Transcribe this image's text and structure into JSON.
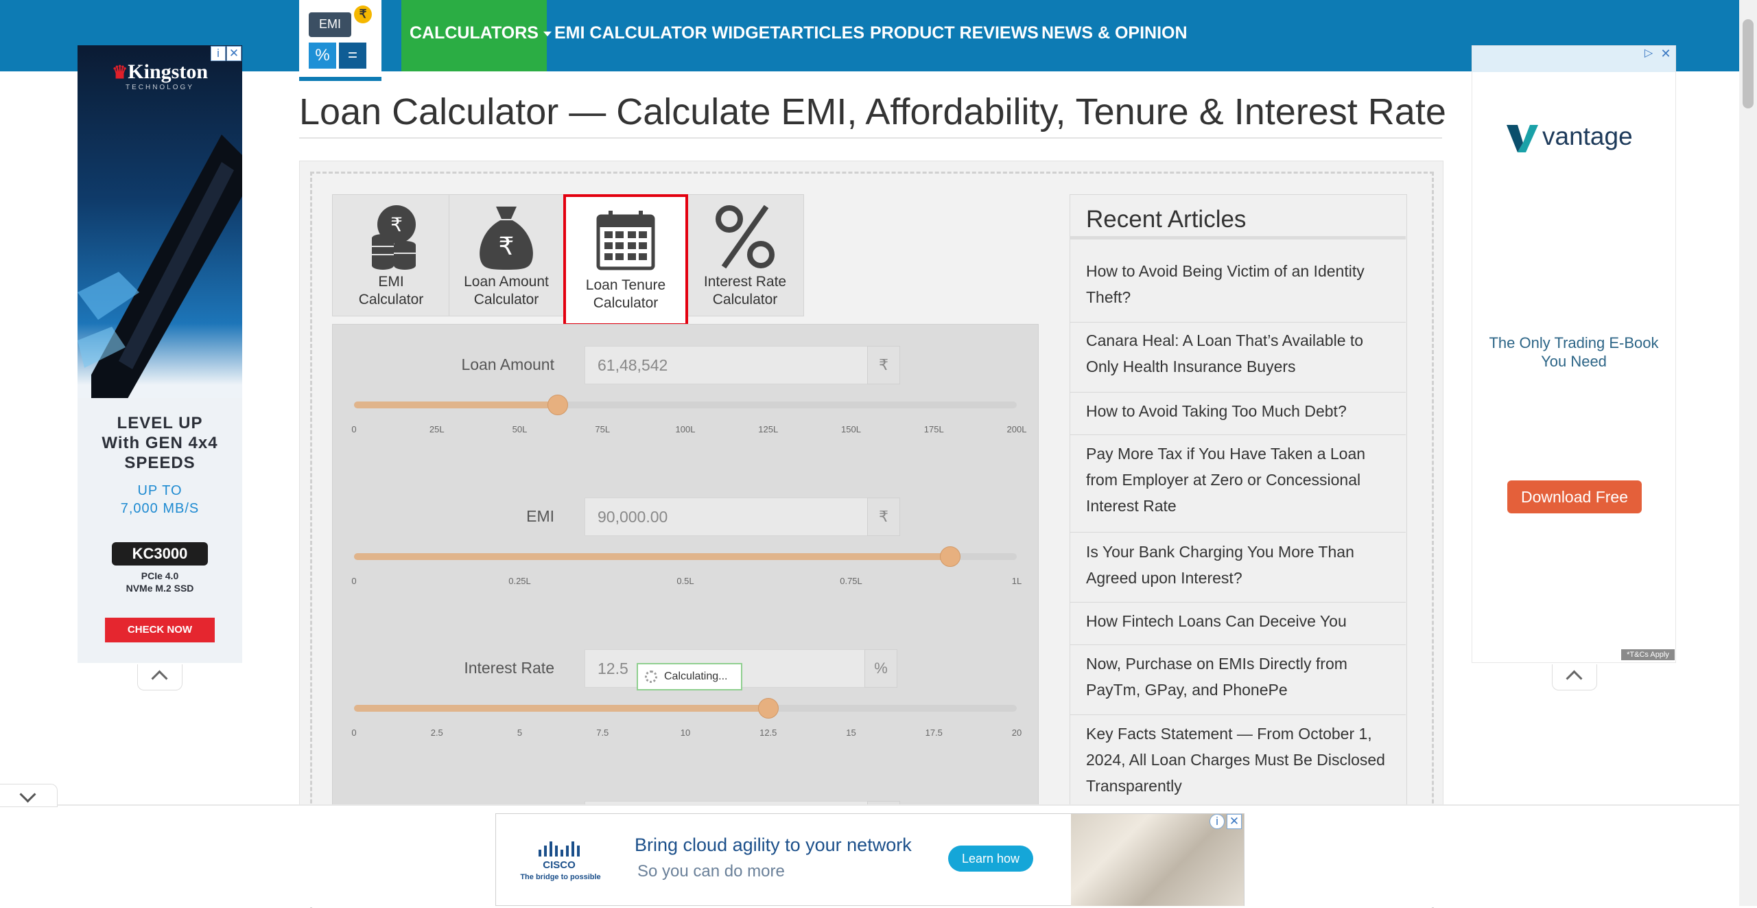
{
  "nav": {
    "logo_top": "EMI",
    "logo_badge": "₹",
    "logo_left": "%",
    "logo_right": "=",
    "items": [
      {
        "label": "CALCULATORS"
      },
      {
        "label": "EMI CALCULATOR WIDGET"
      },
      {
        "label": "ARTICLES"
      },
      {
        "label": "PRODUCT REVIEWS"
      },
      {
        "label": "NEWS & OPINION"
      }
    ]
  },
  "page_title": "Loan Calculator — Calculate EMI, Affordability, Tenure & Interest Rate",
  "tabs": [
    {
      "line1": "EMI",
      "line2": "Calculator",
      "icon": "coins-icon"
    },
    {
      "line1": "Loan Amount",
      "line2": "Calculator",
      "icon": "money-bag-icon"
    },
    {
      "line1": "Loan Tenure",
      "line2": "Calculator",
      "icon": "calendar-icon",
      "active": true
    },
    {
      "line1": "Interest Rate",
      "line2": "Calculator",
      "icon": "percent-icon"
    }
  ],
  "fields": {
    "loan_amount": {
      "label": "Loan Amount",
      "value": "61,48,542",
      "unit": "₹",
      "slider_fraction": 0.307,
      "ticks": [
        "0",
        "25L",
        "50L",
        "75L",
        "100L",
        "125L",
        "150L",
        "175L",
        "200L"
      ]
    },
    "emi": {
      "label": "EMI",
      "value": "90,000.00",
      "unit": "₹",
      "slider_fraction": 0.9,
      "ticks": [
        "0",
        "0.25L",
        "0.5L",
        "0.75L",
        "1L"
      ]
    },
    "interest_rate": {
      "label": "Interest Rate",
      "value": "12.5",
      "unit": "%",
      "slider_fraction": 0.625,
      "ticks": [
        "0",
        "2.5",
        "5",
        "7.5",
        "10",
        "12.5",
        "15",
        "17.5",
        "20"
      ]
    }
  },
  "calculating_text": "Calculating...",
  "recent_articles": {
    "title": "Recent Articles",
    "items": [
      {
        "lines": [
          "How to Avoid Being Victim of an Identity",
          "Theft?"
        ]
      },
      {
        "lines": [
          "Canara Heal: A Loan That’s Available to",
          "Only Health Insurance Buyers"
        ]
      },
      {
        "lines": [
          "How to Avoid Taking Too Much Debt?"
        ]
      },
      {
        "lines": [
          "Pay More Tax if You Have Taken a Loan",
          "from Employer at Zero or Concessional",
          "Interest Rate"
        ]
      },
      {
        "lines": [
          "Is Your Bank Charging You More Than",
          "Agreed upon Interest?"
        ]
      },
      {
        "lines": [
          "How Fintech Loans Can Deceive You"
        ]
      },
      {
        "lines": [
          "Now, Purchase on EMIs Directly from",
          "PayTm, GPay, and PhonePe"
        ]
      },
      {
        "lines": [
          "Key Facts Statement — From October 1,",
          "2024, All Loan Charges Must Be Disclosed",
          "Transparently"
        ]
      }
    ]
  },
  "ads": {
    "left": {
      "brand": "Kingston",
      "brand_sub": "TECHNOLOGY",
      "headline": [
        "LEVEL UP",
        "With GEN 4x4",
        "SPEEDS"
      ],
      "speed": [
        "UP TO",
        "7,000 MB/S"
      ],
      "model": "KC3000",
      "spec": [
        "PCIe 4.0",
        "NVMe M.2 SSD"
      ],
      "cta": "CHECK NOW"
    },
    "right": {
      "brand": "vantage",
      "tagline": [
        "The Only Trading E-Book",
        "You Need"
      ],
      "cta": "Download Free",
      "fine_print": "*T&Cs Apply"
    },
    "bottom": {
      "brand": "CISCO",
      "brand_tag": "The bridge to possible",
      "headline": "Bring cloud agility to your network",
      "subline": "So you can do more",
      "cta": "Learn how"
    },
    "close_glyph": "✕",
    "info_glyph": "i",
    "adchoices_glyph": "▷"
  },
  "colors": {
    "header": "#0d7bb4",
    "nav_active": "#2bad44",
    "active_tab_border": "#e3000f",
    "slider_fill": "#e0b48b",
    "download_button": "#e4603a"
  }
}
